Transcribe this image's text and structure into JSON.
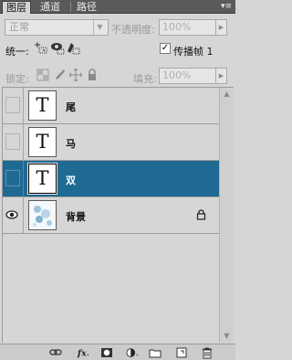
{
  "tabs": [
    {
      "label": "图层",
      "active": true
    },
    {
      "label": "通道",
      "active": false
    },
    {
      "label": "路径",
      "active": false
    }
  ],
  "panel_menu_icon": "panel-menu-icon",
  "blend_mode": {
    "value": "正常"
  },
  "opacity": {
    "label": "不透明度:",
    "value": "100%"
  },
  "unify": {
    "label": "统一:",
    "icons": [
      "unify-position-icon",
      "unify-visibility-icon",
      "unify-style-icon"
    ]
  },
  "propagate": {
    "label": "传播帧 1",
    "checked": true
  },
  "lock": {
    "label": "锁定:",
    "icons": [
      "lock-transparent-icon",
      "lock-pixels-icon",
      "lock-position-icon",
      "lock-all-icon"
    ]
  },
  "fill": {
    "label": "填充:",
    "value": "100%"
  },
  "layers": [
    {
      "name": "尾",
      "type": "text",
      "thumb_glyph": "T",
      "visible": false,
      "selected": false,
      "locked": false
    },
    {
      "name": "马",
      "type": "text",
      "thumb_glyph": "T",
      "visible": false,
      "selected": false,
      "locked": false
    },
    {
      "name": "双",
      "type": "text",
      "thumb_glyph": "T",
      "visible": false,
      "selected": true,
      "locked": false
    },
    {
      "name": "背景",
      "type": "image",
      "visible": true,
      "selected": false,
      "locked": true
    }
  ],
  "toolbar_icons": [
    "link-layers-icon",
    "fx-icon",
    "add-mask-icon",
    "adjustment-layer-icon",
    "new-group-icon",
    "new-layer-icon",
    "delete-layer-icon"
  ],
  "colors": {
    "selected_row": "#1f6a93",
    "panel_bg": "#d6d6d6",
    "tab_bar": "#5a5a5a"
  }
}
